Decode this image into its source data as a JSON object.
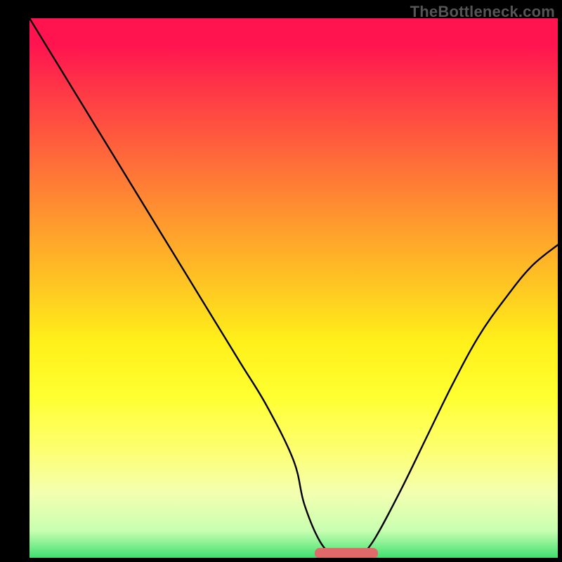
{
  "watermark": "TheBottleneck.com",
  "colors": {
    "frame_bg": "#000000",
    "curve": "#000000",
    "marker": "#e06a6a",
    "gradient_top": "#ff1450",
    "gradient_bottom": "#40e070"
  },
  "chart_data": {
    "type": "line",
    "title": "",
    "xlabel": "",
    "ylabel": "",
    "xlim": [
      0,
      100
    ],
    "ylim": [
      0,
      100
    ],
    "grid": false,
    "legend": false,
    "series": [
      {
        "name": "bottleneck-curve",
        "x": [
          0,
          5,
          10,
          15,
          20,
          25,
          30,
          35,
          40,
          45,
          50,
          52,
          55,
          58,
          60,
          62,
          65,
          70,
          75,
          80,
          85,
          90,
          95,
          100
        ],
        "y": [
          100,
          92,
          84,
          76,
          68,
          60,
          52,
          44,
          36,
          28,
          18,
          10,
          3,
          0,
          0,
          0,
          3,
          12,
          22,
          32,
          41,
          48,
          54,
          58
        ]
      }
    ],
    "annotations": [
      {
        "name": "flat-minimum-marker",
        "x_start": 54,
        "x_end": 66,
        "y": 0
      }
    ],
    "background_gradient": {
      "direction": "vertical",
      "stops": [
        {
          "pos": 0,
          "color": "#ff1450"
        },
        {
          "pos": 0.5,
          "color": "#ffc822"
        },
        {
          "pos": 0.7,
          "color": "#ffff30"
        },
        {
          "pos": 1,
          "color": "#40e070"
        }
      ]
    }
  }
}
